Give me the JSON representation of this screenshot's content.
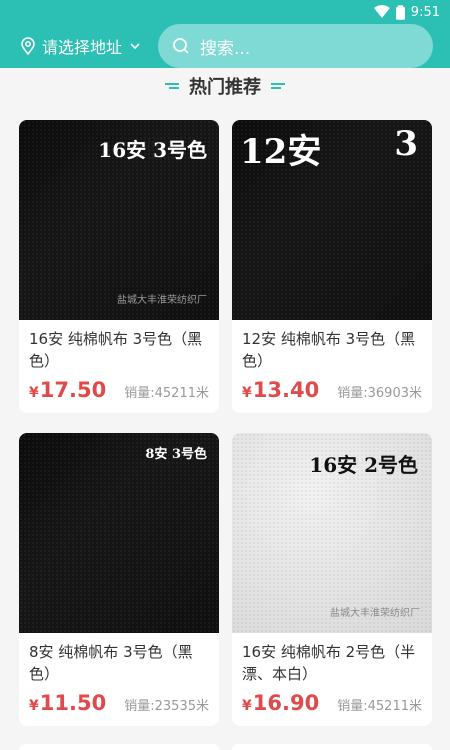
{
  "status": {
    "time": "9:51"
  },
  "header": {
    "location_label": "请选择地址",
    "search_placeholder": "搜索..."
  },
  "section": {
    "title": "热门推荐"
  },
  "products": [
    {
      "title": "16安 纯棉帆布 3号色（黑色）",
      "price": "17.50",
      "currency": "¥",
      "sales": "销量:45211米",
      "image_tag": "16安 3号色",
      "image_tag_2": "",
      "watermark": "盐城大丰淮荣纺织厂"
    },
    {
      "title": "12安 纯棉帆布 3号色（黑色）",
      "price": "13.40",
      "currency": "¥",
      "sales": "销量:36903米",
      "image_tag": "12安",
      "image_tag_2": "3",
      "watermark": ""
    },
    {
      "title": "8安 纯棉帆布 3号色（黑色）",
      "price": "11.50",
      "currency": "¥",
      "sales": "销量:23535米",
      "image_tag": "8安 3号色",
      "image_tag_2": "",
      "watermark": ""
    },
    {
      "title": "16安 纯棉帆布 2号色（半漂、本白）",
      "price": "16.90",
      "currency": "¥",
      "sales": "销量:45211米",
      "image_tag": "16安 2号色",
      "image_tag_2": "",
      "watermark": "盐城大丰淮荣纺织厂"
    }
  ],
  "colors": {
    "primary": "#2cbfb4",
    "price": "#e04a4a"
  }
}
